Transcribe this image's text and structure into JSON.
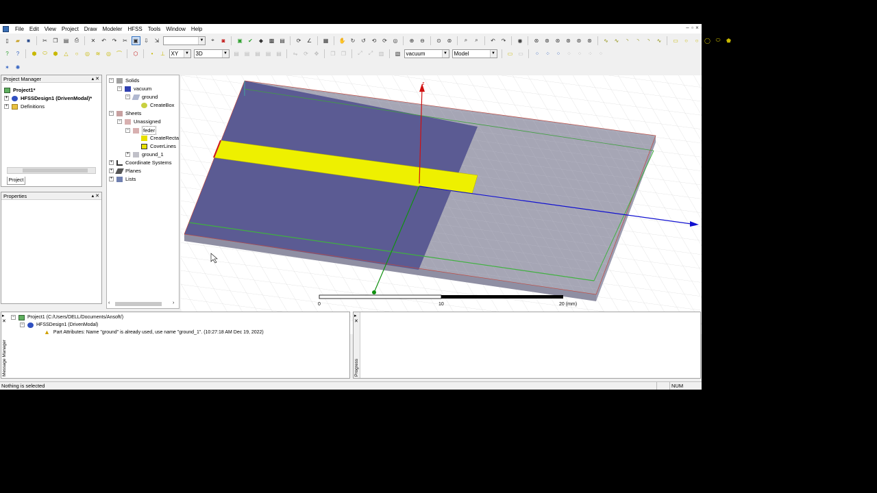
{
  "menu": [
    "File",
    "Edit",
    "View",
    "Project",
    "Draw",
    "Modeler",
    "HFSS",
    "Tools",
    "Window",
    "Help"
  ],
  "toolbar": {
    "plane_combo": "XY",
    "dim_combo": "3D",
    "material_combo": "vacuum",
    "model_combo": "Model",
    "blank_combo": ""
  },
  "project_manager": {
    "title": "Project Manager",
    "items": [
      {
        "label": "Project1*",
        "bold": true
      },
      {
        "label": "HFSSDesign1 (DrivenModal)*",
        "bold": true
      },
      {
        "label": "Definitions",
        "bold": false
      }
    ],
    "tab": "Project"
  },
  "properties": {
    "title": "Properties"
  },
  "model_tree": [
    {
      "label": "Solids"
    },
    {
      "label": "vacuum"
    },
    {
      "label": "ground"
    },
    {
      "label": "CreateBox"
    },
    {
      "label": "Sheets"
    },
    {
      "label": "Unassigned"
    },
    {
      "label": "feder"
    },
    {
      "label": "CreateRecta"
    },
    {
      "label": "CoverLines"
    },
    {
      "label": "ground_1"
    },
    {
      "label": "Coordinate Systems"
    },
    {
      "label": "Planes"
    },
    {
      "label": "Lists"
    }
  ],
  "viewport": {
    "axis_z": "z",
    "scale_labels": [
      "0",
      "10",
      "20 (mm)"
    ]
  },
  "messages": {
    "panel_label": "Message Manager",
    "project_line": "Project1 (C:/Users/DELL/Documents/Ansoft/)",
    "design_line": "HFSSDesign1 (DrivenModal)",
    "warning": "Part Attributes: Name \"ground\" is already used, use name \"ground_1\". (10:27:18 AM  Dec 19, 2022)"
  },
  "progress": {
    "panel_label": "Progress"
  },
  "status": {
    "text": "Nothing is selected",
    "num": "NUM"
  },
  "colors": {
    "substrate_blue": "#5b5b93",
    "gray_face": "#a0a0b0",
    "feed_yellow": "#eef000",
    "axis_red": "#d01010",
    "axis_blue": "#1010d0",
    "axis_green": "#109010"
  }
}
